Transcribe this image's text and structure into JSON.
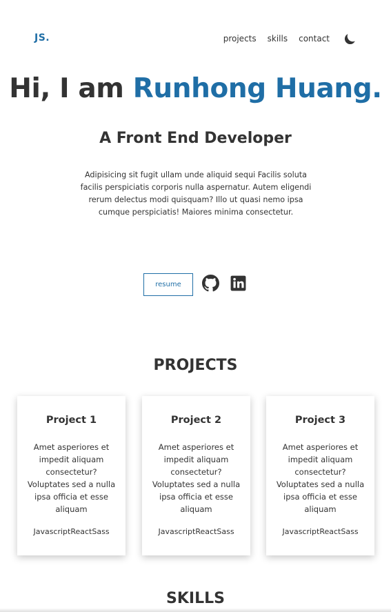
{
  "header": {
    "logo": "JS.",
    "nav": [
      "projects",
      "skills",
      "contact"
    ],
    "theme_icon": "moon-icon"
  },
  "hero": {
    "greeting": "Hi, I am ",
    "name": "Runhong Huang.",
    "subtitle": "A Front End Developer",
    "intro": "Adipisicing sit fugit ullam unde aliquid sequi Facilis soluta facilis perspiciatis corporis nulla aspernatur. Autem eligendi rerum delectus modi quisquam? Illo ut quasi nemo ipsa cumque perspiciatis! Maiores minima consectetur.",
    "resume_label": "resume",
    "social_icons": [
      "github-icon",
      "linkedin-icon"
    ]
  },
  "projects": {
    "title": "PROJECTS",
    "items": [
      {
        "title": "Project 1",
        "description": "Amet asperiores et impedit aliquam consectetur? Voluptates sed a nulla ipsa officia et esse aliquam",
        "stack": "JavascriptReactSass"
      },
      {
        "title": "Project 2",
        "description": "Amet asperiores et impedit aliquam consectetur? Voluptates sed a nulla ipsa officia et esse aliquam",
        "stack": "JavascriptReactSass"
      },
      {
        "title": "Project 3",
        "description": "Amet asperiores et impedit aliquam consectetur? Voluptates sed a nulla ipsa officia et esse aliquam",
        "stack": "JavascriptReactSass"
      }
    ]
  },
  "skills": {
    "title": "SKILLS"
  },
  "colors": {
    "accent": "#1f6ea6",
    "text": "#333333",
    "background": "#ffffff"
  }
}
